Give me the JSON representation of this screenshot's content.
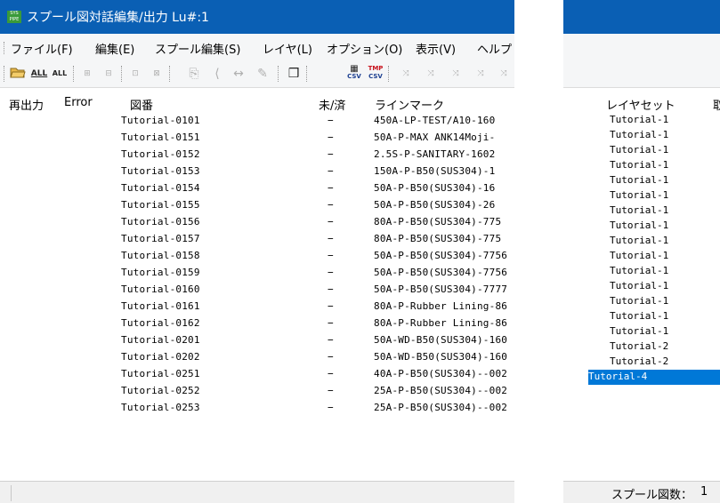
{
  "main_window": {
    "title": "スプール図対話編集/出力 Lu#:1",
    "app_icon_text": "SYS PIPE",
    "menu": [
      "ファイル(F)",
      "編集(E)",
      "スプール編集(S)",
      "レイヤ(L)",
      "オプション(O)",
      "表示(V)",
      "ヘルプ"
    ],
    "toolbar": {
      "all1": "ALL",
      "all2": "ALL",
      "csv1": "CSV",
      "csv2": "CSV",
      "tmp": "TMP"
    },
    "columns": [
      "再出力",
      "Error",
      "図番",
      "未/済",
      "ラインマーク"
    ],
    "rows": [
      {
        "drawing": "Tutorial-0101",
        "status": "−",
        "linemark": "450A-LP-TEST/A10-160"
      },
      {
        "drawing": "Tutorial-0151",
        "status": "−",
        "linemark": "50A-P-MAX ANK14Moji-"
      },
      {
        "drawing": "Tutorial-0152",
        "status": "−",
        "linemark": "2.5S-P-SANITARY-1602"
      },
      {
        "drawing": "Tutorial-0153",
        "status": "−",
        "linemark": "150A-P-B50(SUS304)-1"
      },
      {
        "drawing": "Tutorial-0154",
        "status": "−",
        "linemark": "50A-P-B50(SUS304)-16"
      },
      {
        "drawing": "Tutorial-0155",
        "status": "−",
        "linemark": "50A-P-B50(SUS304)-26"
      },
      {
        "drawing": "Tutorial-0156",
        "status": "−",
        "linemark": "80A-P-B50(SUS304)-775"
      },
      {
        "drawing": "Tutorial-0157",
        "status": "−",
        "linemark": "80A-P-B50(SUS304)-775"
      },
      {
        "drawing": "Tutorial-0158",
        "status": "−",
        "linemark": "50A-P-B50(SUS304)-7756"
      },
      {
        "drawing": "Tutorial-0159",
        "status": "−",
        "linemark": "50A-P-B50(SUS304)-7756"
      },
      {
        "drawing": "Tutorial-0160",
        "status": "−",
        "linemark": "50A-P-B50(SUS304)-7777"
      },
      {
        "drawing": "Tutorial-0161",
        "status": "−",
        "linemark": "80A-P-Rubber Lining-86"
      },
      {
        "drawing": "Tutorial-0162",
        "status": "−",
        "linemark": "80A-P-Rubber Lining-86"
      },
      {
        "drawing": "Tutorial-0201",
        "status": "−",
        "linemark": "50A-WD-B50(SUS304)-160"
      },
      {
        "drawing": "Tutorial-0202",
        "status": "−",
        "linemark": "50A-WD-B50(SUS304)-160"
      },
      {
        "drawing": "Tutorial-0251",
        "status": "−",
        "linemark": "40A-P-B50(SUS304)--002"
      },
      {
        "drawing": "Tutorial-0252",
        "status": "−",
        "linemark": "25A-P-B50(SUS304)--002"
      },
      {
        "drawing": "Tutorial-0253",
        "status": "−",
        "linemark": "25A-P-B50(SUS304)--002"
      }
    ]
  },
  "side_window": {
    "columns": [
      "レイヤセット",
      "取"
    ],
    "rows": [
      "Tutorial-1",
      "Tutorial-1",
      "Tutorial-1",
      "Tutorial-1",
      "Tutorial-1",
      "Tutorial-1",
      "Tutorial-1",
      "Tutorial-1",
      "Tutorial-1",
      "Tutorial-1",
      "Tutorial-1",
      "Tutorial-1",
      "Tutorial-1",
      "Tutorial-1",
      "Tutorial-1",
      "Tutorial-2",
      "Tutorial-2",
      "Tutorial-4"
    ],
    "selected_index": 17,
    "status_label": "スプール図数：",
    "status_value": "1"
  },
  "colors": {
    "titlebar": "#0a5fb4",
    "selection": "#0078d7",
    "menubar": "#f5f6f7"
  }
}
